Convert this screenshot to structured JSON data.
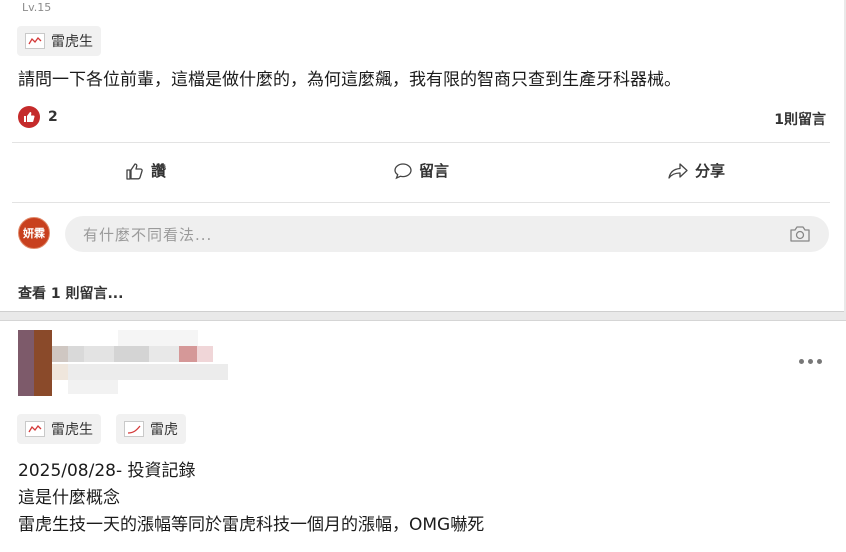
{
  "post1": {
    "level": "Lv.15",
    "tag": "雷虎生",
    "text": "請問一下各位前輩，這檔是做什麼的，為何這麼飆，我有限的智商只查到生產牙科器械。",
    "like_count": "2",
    "comment_count": "1則留言",
    "actions": {
      "like": "讚",
      "comment": "留言",
      "share": "分享"
    },
    "commenter_avatar": "妍霖",
    "comment_placeholder": "有什麼不同看法...",
    "view_comments": "查看 1 則留言..."
  },
  "post2": {
    "tags": [
      "雷虎生",
      "雷虎"
    ],
    "lines": [
      "2025/08/28- 投資記錄",
      "這是什麼概念",
      "雷虎生技一天的漲幅等同於雷虎科技一個月的漲幅，OMG嚇死"
    ]
  },
  "colors": {
    "like_red": "#c52b2b",
    "avatar_bg": "#c8401e"
  }
}
